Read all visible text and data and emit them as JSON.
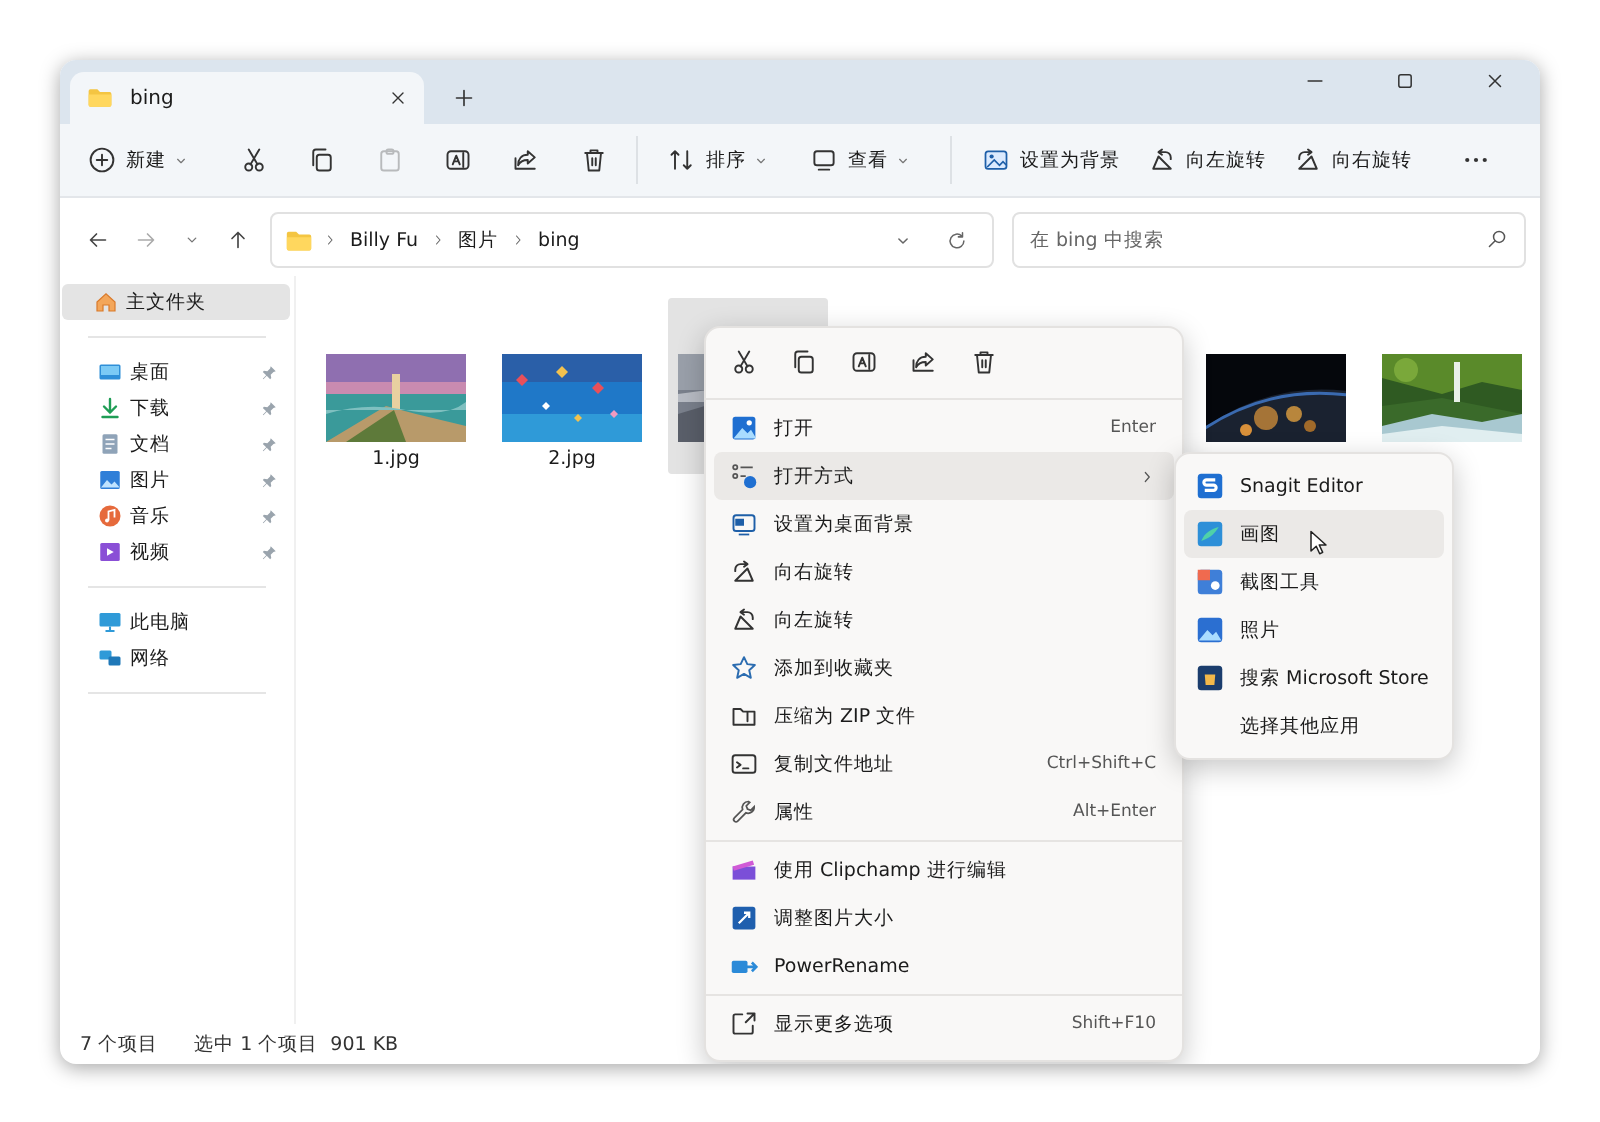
{
  "window": {
    "tabs": [
      {
        "title": "bing",
        "selected": true
      }
    ]
  },
  "toolbar": {
    "items": [
      {
        "kind": "menu",
        "label": "新建"
      },
      {
        "kind": "icon",
        "disabled": false
      },
      {
        "kind": "icon",
        "disabled": false
      },
      {
        "kind": "icon",
        "disabled": true
      },
      {
        "kind": "icon",
        "disabled": false
      },
      {
        "kind": "icon",
        "disabled": false
      },
      {
        "kind": "icon",
        "disabled": false
      },
      {
        "kind": "separator"
      },
      {
        "kind": "menu",
        "label": "排序"
      },
      {
        "kind": "menu",
        "label": "查看"
      },
      {
        "kind": "separator"
      },
      {
        "kind": "button",
        "label": "设置为背景"
      },
      {
        "kind": "button",
        "label": "向左旋转"
      },
      {
        "kind": "button",
        "label": "向右旋转"
      },
      {
        "kind": "more"
      }
    ]
  },
  "address": {
    "path": [
      "Billy Fu",
      "图片",
      "bing"
    ],
    "search_placeholder": "在 bing 中搜索"
  },
  "sidebar": {
    "groups": [
      {
        "items": [
          {
            "label": "主文件夹",
            "selected": true,
            "pinned": false
          }
        ]
      },
      {
        "items": [
          {
            "label": "桌面",
            "selected": false,
            "pinned": true
          },
          {
            "label": "下载",
            "selected": false,
            "pinned": true
          },
          {
            "label": "文档",
            "selected": false,
            "pinned": true
          },
          {
            "label": "图片",
            "selected": false,
            "pinned": true
          },
          {
            "label": "音乐",
            "selected": false,
            "pinned": true
          },
          {
            "label": "视频",
            "selected": false,
            "pinned": true
          }
        ]
      },
      {
        "items": [
          {
            "label": "此电脑",
            "selected": false,
            "pinned": false
          },
          {
            "label": "网络",
            "selected": false,
            "pinned": false
          }
        ]
      }
    ]
  },
  "files": [
    {
      "kind": "picture",
      "name": "1.jpg",
      "selected": false
    },
    {
      "kind": "picture",
      "name": "2.jpg",
      "selected": false
    },
    {
      "kind": "picture",
      "selected": true
    },
    {
      "kind": "covered"
    },
    {
      "kind": "covered"
    },
    {
      "kind": "picture",
      "selected": false
    },
    {
      "kind": "picture",
      "selected": false
    }
  ],
  "status_bar": {
    "count": "7 个项目",
    "selection": "选中 1 个项目",
    "size": "901 KB"
  },
  "context_menu": {
    "groups": [
      {
        "items": [
          {
            "label": "打开",
            "shortcut": "Enter",
            "submenu": false,
            "highlighted": false
          },
          {
            "label": "打开方式",
            "submenu": true,
            "highlighted": true
          },
          {
            "label": "设置为桌面背景",
            "submenu": false,
            "highlighted": false
          },
          {
            "label": "向右旋转",
            "submenu": false,
            "highlighted": false
          },
          {
            "label": "向左旋转",
            "submenu": false,
            "highlighted": false
          },
          {
            "label": "添加到收藏夹",
            "submenu": false,
            "highlighted": false
          },
          {
            "label": "压缩为 ZIP 文件",
            "submenu": false,
            "highlighted": false
          },
          {
            "label": "复制文件地址",
            "shortcut": "Ctrl+Shift+C",
            "submenu": false,
            "highlighted": false
          },
          {
            "label": "属性",
            "shortcut": "Alt+Enter",
            "submenu": false,
            "highlighted": false
          }
        ]
      },
      {
        "items": [
          {
            "label": "使用 Clipchamp 进行编辑",
            "submenu": false,
            "highlighted": false
          },
          {
            "label": "调整图片大小",
            "submenu": false,
            "highlighted": false
          },
          {
            "label": "PowerRename",
            "submenu": false,
            "highlighted": false
          }
        ]
      },
      {
        "items": [
          {
            "label": "显示更多选项",
            "shortcut": "Shift+F10",
            "submenu": false,
            "highlighted": false
          }
        ]
      }
    ]
  },
  "submenu": {
    "items": [
      {
        "label": "Snagit Editor",
        "highlighted": false
      },
      {
        "label": "画图",
        "highlighted": true
      },
      {
        "label": "截图工具",
        "highlighted": false
      },
      {
        "label": "照片",
        "highlighted": false
      },
      {
        "label": "搜索 Microsoft Store",
        "highlighted": false
      },
      {
        "label": "选择其他应用",
        "highlighted": false
      }
    ]
  }
}
